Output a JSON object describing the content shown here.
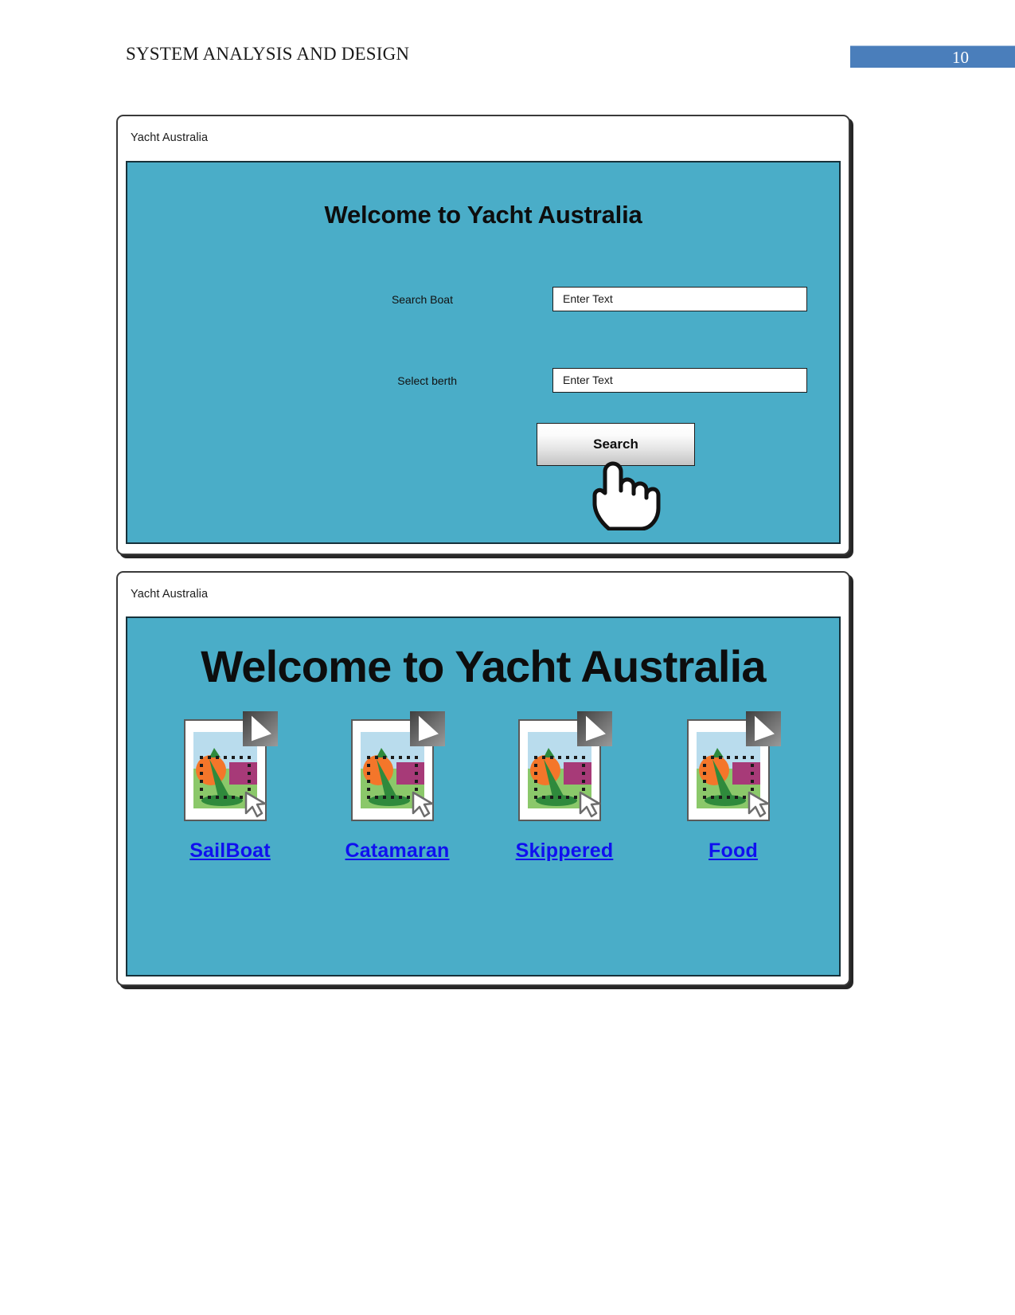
{
  "document": {
    "header_title": "SYSTEM ANALYSIS AND DESIGN",
    "page_number": "10",
    "page_badge_color": "#4a7ebb"
  },
  "mockups": [
    {
      "window_title": "Yacht Australia",
      "screen_bg": "#4aadc8",
      "heading": "Welcome to Yacht Australia",
      "fields": [
        {
          "label": "Search Boat",
          "value": "Enter Text",
          "placeholder": "Enter Text"
        },
        {
          "label": "Select berth",
          "value": "Enter Text",
          "placeholder": "Enter Text"
        }
      ],
      "button": {
        "label": "Search",
        "icon": "hand-pointer-cursor"
      }
    },
    {
      "window_title": "Yacht Australia",
      "screen_bg": "#4aadc8",
      "heading": "Welcome to Yacht Australia",
      "items": [
        {
          "label": "SailBoat",
          "icon": "image-placeholder-icon",
          "link_color": "#1010ef"
        },
        {
          "label": "Catamaran",
          "icon": "image-placeholder-icon",
          "link_color": "#1010ef"
        },
        {
          "label": "Skippered",
          "icon": "image-placeholder-icon",
          "link_color": "#1010ef"
        },
        {
          "label": "Food",
          "icon": "image-placeholder-icon",
          "link_color": "#1010ef"
        }
      ]
    }
  ]
}
